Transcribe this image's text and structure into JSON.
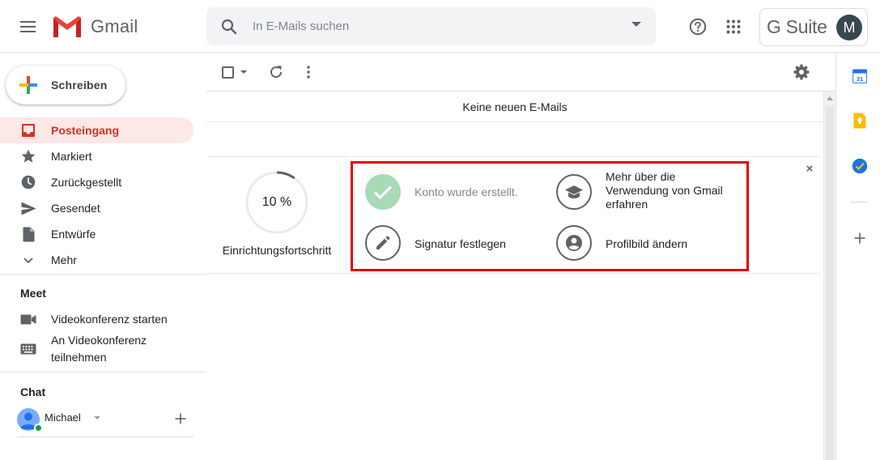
{
  "header": {
    "app_name": "Gmail",
    "search_placeholder": "In E-Mails suchen",
    "brand": "G Suite",
    "avatar_letter": "M",
    "icons": [
      "menu-icon",
      "gmail-logo-icon",
      "search-icon",
      "help-icon",
      "apps-icon"
    ]
  },
  "nav": {
    "compose_label": "Schreiben",
    "items": [
      {
        "label": "Posteingang",
        "icon": "inbox-icon",
        "active": true
      },
      {
        "label": "Markiert",
        "icon": "star-icon"
      },
      {
        "label": "Zurückgestellt",
        "icon": "clock-icon"
      },
      {
        "label": "Gesendet",
        "icon": "send-icon"
      },
      {
        "label": "Entwürfe",
        "icon": "draft-icon"
      },
      {
        "label": "Mehr",
        "icon": "chevron-down-icon"
      }
    ]
  },
  "meet": {
    "title": "Meet",
    "start": "Videokonferenz starten",
    "join": "An Videokonferenz teilnehmen"
  },
  "chat": {
    "title": "Chat",
    "user": "Michael"
  },
  "main": {
    "no_mail": "Keine neuen E-Mails",
    "setup": {
      "progress_text": "10 %",
      "progress_value": 10,
      "progress_label": "Einrichtungsfortschritt",
      "tasks": [
        {
          "label": "Konto wurde erstellt.",
          "icon": "check-icon",
          "done": true
        },
        {
          "label": "Mehr über die Verwendung von Gmail erfahren",
          "icon": "school-icon",
          "done": false
        },
        {
          "label": "Signatur festlegen",
          "icon": "pencil-icon",
          "done": false
        },
        {
          "label": "Profilbild ändern",
          "icon": "account-circle-icon",
          "done": false
        }
      ],
      "close": "×"
    }
  },
  "colors": {
    "active_nav_bg": "#fce8e6",
    "active_nav_text": "#d93025",
    "highlight_border": "#e00000",
    "done_task_bg": "#a8dab5"
  }
}
